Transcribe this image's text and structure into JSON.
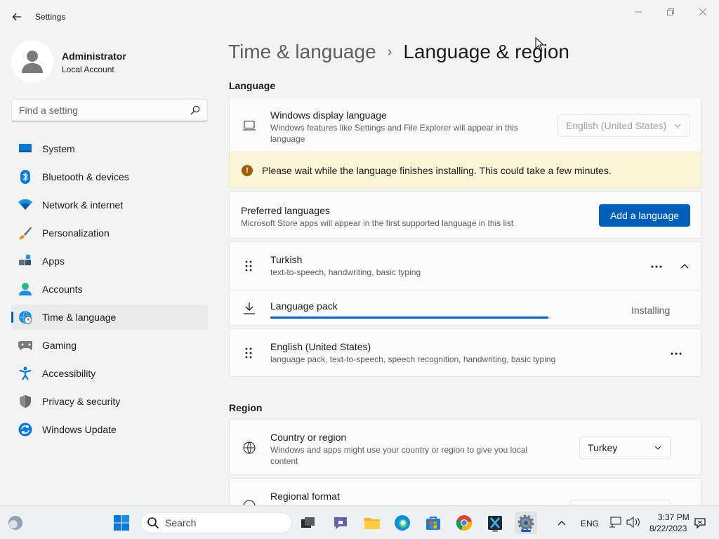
{
  "window": {
    "title": "Settings"
  },
  "user": {
    "name": "Administrator",
    "account_type": "Local Account"
  },
  "search": {
    "placeholder": "Find a setting"
  },
  "sidebar": {
    "items": [
      {
        "label": "System",
        "icon": "system-icon"
      },
      {
        "label": "Bluetooth & devices",
        "icon": "bluetooth-icon"
      },
      {
        "label": "Network & internet",
        "icon": "wifi-icon"
      },
      {
        "label": "Personalization",
        "icon": "brush-icon"
      },
      {
        "label": "Apps",
        "icon": "apps-icon"
      },
      {
        "label": "Accounts",
        "icon": "accounts-icon"
      },
      {
        "label": "Time & language",
        "icon": "globe-clock-icon",
        "active": true
      },
      {
        "label": "Gaming",
        "icon": "gamepad-icon"
      },
      {
        "label": "Accessibility",
        "icon": "accessibility-icon"
      },
      {
        "label": "Privacy & security",
        "icon": "shield-icon"
      },
      {
        "label": "Windows Update",
        "icon": "update-icon"
      }
    ]
  },
  "breadcrumb": {
    "parent": "Time & language",
    "separator": "›",
    "current": "Language & region"
  },
  "language_section": {
    "title": "Language",
    "display_language": {
      "title": "Windows display language",
      "description": "Windows features like Settings and File Explorer will appear in this language",
      "selected": "English (United States)"
    },
    "warning": "Please wait while the language finishes installing. This could take a few minutes.",
    "preferred": {
      "title": "Preferred languages",
      "description": "Microsoft Store apps will appear in the first supported language in this list",
      "add_button": "Add a language"
    },
    "languages": [
      {
        "name": "Turkish",
        "features": "text-to-speech, handwriting, basic typing",
        "expanded": true,
        "pack": {
          "label": "Language pack",
          "status": "Installing",
          "progress": 0.99
        }
      },
      {
        "name": "English (United States)",
        "features": "language pack, text-to-speech, speech recognition, handwriting, basic typing"
      }
    ]
  },
  "region_section": {
    "title": "Region",
    "country": {
      "title": "Country or region",
      "description": "Windows and apps might use your country or region to give you local content",
      "selected": "Turkey"
    },
    "format": {
      "title": "Regional format"
    }
  },
  "taskbar": {
    "search_label": "Search",
    "language": "ENG",
    "time": "3:37 PM",
    "date": "8/22/2023"
  },
  "colors": {
    "accent": "#005fb8",
    "warning_bg": "#fcf4d6",
    "warning_icon": "#9d5d00"
  }
}
